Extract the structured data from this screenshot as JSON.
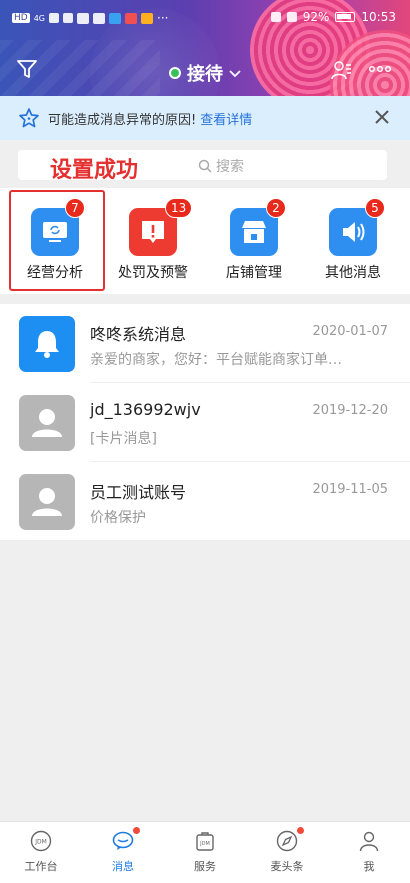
{
  "status_bar": {
    "network_left": "HD",
    "network_gen": "4G",
    "battery_percent": "92%",
    "time": "10:53"
  },
  "header": {
    "title": "接待"
  },
  "notice": {
    "text": "可能造成消息异常的原因!",
    "link": "查看详情"
  },
  "search": {
    "placeholder": "搜索"
  },
  "toast": {
    "text": "设置成功"
  },
  "quick_entries": [
    {
      "label": "经营分析",
      "badge": "7",
      "color": "#2f8ff0",
      "icon": "refresh-screen-icon"
    },
    {
      "label": "处罚及预警",
      "badge": "13",
      "color": "#ee3b32",
      "icon": "warning-icon"
    },
    {
      "label": "店铺管理",
      "badge": "2",
      "color": "#2f8ff0",
      "icon": "store-icon"
    },
    {
      "label": "其他消息",
      "badge": "5",
      "color": "#2f8ff0",
      "icon": "speaker-icon"
    }
  ],
  "messages": [
    {
      "name": "咚咚系统消息",
      "date": "2020-01-07",
      "preview": "亲爱的商家，您好：平台赋能商家订单…",
      "avatar": "bell-icon"
    },
    {
      "name": "jd_136992wjv",
      "date": "2019-12-20",
      "preview": "[卡片消息]",
      "avatar": "user-avatar-icon"
    },
    {
      "name": "员工测试账号",
      "date": "2019-11-05",
      "preview": "价格保护",
      "avatar": "user-avatar-icon"
    }
  ],
  "tabbar": [
    {
      "label": "工作台",
      "icon": "jdm-circle-icon",
      "active": false,
      "dot": false
    },
    {
      "label": "消息",
      "icon": "message-icon",
      "active": true,
      "dot": true
    },
    {
      "label": "服务",
      "icon": "jdm-bag-icon",
      "active": false,
      "dot": false
    },
    {
      "label": "麦头条",
      "icon": "compass-icon",
      "active": false,
      "dot": true
    },
    {
      "label": "我",
      "icon": "person-icon",
      "active": false,
      "dot": false
    }
  ],
  "colors": {
    "accent": "#1f7be0",
    "badge": "#e8291c",
    "highlight": "#e53030",
    "online": "#38c05a"
  }
}
